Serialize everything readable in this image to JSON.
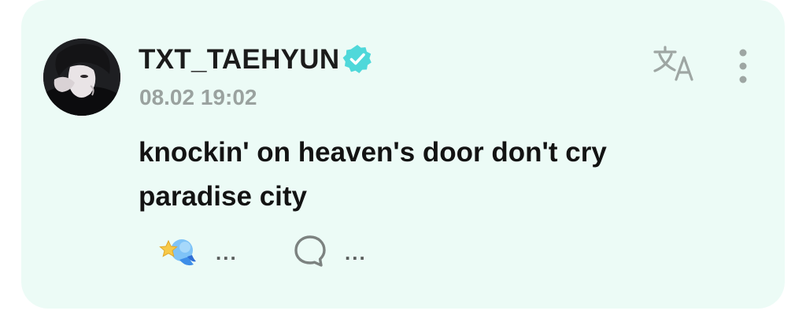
{
  "post": {
    "author": {
      "username": "TXT_TAEHYUN",
      "verified_icon": "verified-badge-icon",
      "avatar": "profile-photo"
    },
    "timestamp": "08.02 19:02",
    "body": "knockin' on heaven's door don't cry\nparadise city",
    "actions": {
      "reaction": {
        "icon": "star-reaction-icon",
        "count": "..."
      },
      "comment": {
        "icon": "comment-bubble-icon",
        "count": "..."
      }
    },
    "header_icons": {
      "translate": "translate-icon",
      "more": "more-options-icon"
    }
  },
  "colors": {
    "card_background": "#ecfbf6",
    "verified_badge": "#4fd8da",
    "timestamp": "#9aa29f"
  }
}
